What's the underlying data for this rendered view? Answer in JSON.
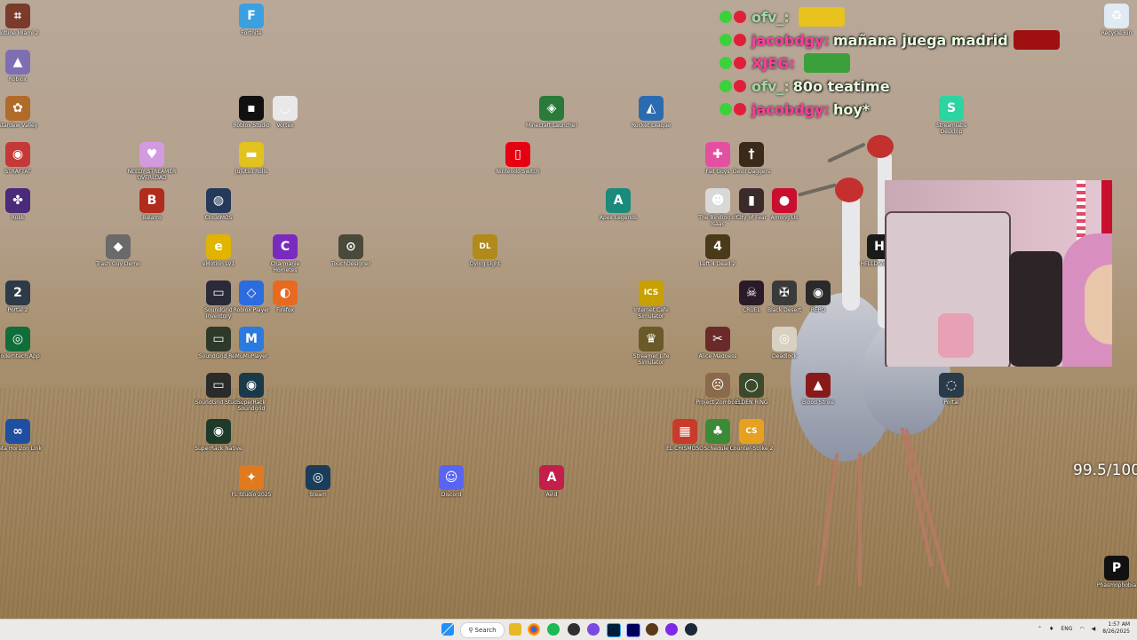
{
  "desktop_icons": [
    {
      "label": "Hotline Miami 2",
      "color": "#7a3b2a",
      "glyph": "⌗"
    },
    {
      "label": "Roblox",
      "color": "#7e6fb3",
      "glyph": "▲"
    },
    {
      "label": "Stardew Valley",
      "color": "#b06a2a",
      "glyph": "✿"
    },
    {
      "label": "STRAFTAT",
      "color": "#c53838",
      "glyph": "◉"
    },
    {
      "label": "Rukk",
      "color": "#4a2b7a",
      "glyph": "✤"
    },
    {
      "label": "Portal 2",
      "color": "#2c3a4a",
      "glyph": "2"
    },
    {
      "label": "Moderntech App",
      "color": "#0f6e3a",
      "glyph": "◎"
    },
    {
      "label": "Meta Horizon Link",
      "color": "#1f4fa0",
      "glyph": "∞"
    },
    {
      "label": "Fortnite",
      "color": "#3aa0e0",
      "glyph": "F"
    },
    {
      "label": "Roblox Studio",
      "color": "#111111",
      "glyph": "▪"
    },
    {
      "label": "Vortex",
      "color": "#e8e8e8",
      "glyph": "◡"
    },
    {
      "label": "NEEDY STREAMER OVERLOAD",
      "color": "#d39ae0",
      "glyph": "♥"
    },
    {
      "label": "Jujutsu Rolls",
      "color": "#e2c21d",
      "glyph": "▬"
    },
    {
      "label": "Balatro",
      "color": "#b02c1e",
      "glyph": "B"
    },
    {
      "label": "CloudMOS",
      "color": "#253a5a",
      "glyph": "◍"
    },
    {
      "label": "Trash Guy Demo",
      "color": "#6a6a6a",
      "glyph": "◆"
    },
    {
      "label": "eMotion LV1",
      "color": "#e0b400",
      "glyph": "e"
    },
    {
      "label": "Charmanie Hometes",
      "color": "#7a2bbf",
      "glyph": "C"
    },
    {
      "label": "TouchDesigner",
      "color": "#4a4a3a",
      "glyph": "⊙"
    },
    {
      "label": "SoundGrid Inventory",
      "color": "#2a2a3a",
      "glyph": "▭"
    },
    {
      "label": "Roblox Player",
      "color": "#2b6ce0",
      "glyph": "◇"
    },
    {
      "label": "Firefox",
      "color": "#e86a1f",
      "glyph": "◐"
    },
    {
      "label": "SoundGrid Rec",
      "color": "#2d3a2a",
      "glyph": "▭"
    },
    {
      "label": "MuMuPlayer",
      "color": "#2b7ae0",
      "glyph": "M"
    },
    {
      "label": "SoundGrid Studio",
      "color": "#2b2b2b",
      "glyph": "▭"
    },
    {
      "label": "SuperRack Soundgrid",
      "color": "#1a3a4a",
      "glyph": "◉"
    },
    {
      "label": "SuperRack Native",
      "color": "#1e3a2a",
      "glyph": "◉"
    },
    {
      "label": "FL Studio 2025",
      "color": "#e07a1f",
      "glyph": "✦"
    },
    {
      "label": "Steam",
      "color": "#1a3d5a",
      "glyph": "◎"
    },
    {
      "label": "Discord",
      "color": "#5865f2",
      "glyph": "☺"
    },
    {
      "label": "Avid",
      "color": "#c41e4a",
      "glyph": "A"
    },
    {
      "label": "Nintendo Switch",
      "color": "#e60012",
      "glyph": "▯"
    },
    {
      "label": "Dying Light",
      "color": "#b08a1a",
      "glyph": "DL"
    },
    {
      "label": "Minecraft Launcher",
      "color": "#2a7a3a",
      "glyph": "◈"
    },
    {
      "label": "Rocket League",
      "color": "#2b6cb0",
      "glyph": "◭"
    },
    {
      "label": "Apex Legends",
      "color": "#1a8a7a",
      "glyph": "A"
    },
    {
      "label": "Internet Cafe Simulator",
      "color": "#c8a000",
      "glyph": "ICS"
    },
    {
      "label": "Streamer Life Simulator",
      "color": "#6a5a2a",
      "glyph": "♛"
    },
    {
      "label": "Fall Guys",
      "color": "#e34fa1",
      "glyph": "✚"
    },
    {
      "label": "Devil Daggers",
      "color": "#3a2a1a",
      "glyph": "†"
    },
    {
      "label": "The Binding of Isaac",
      "color": "#d8d8d8",
      "glyph": "☻"
    },
    {
      "label": "City of Fear",
      "color": "#3a2a2a",
      "glyph": "▮"
    },
    {
      "label": "Among Us",
      "color": "#c8102e",
      "glyph": "●"
    },
    {
      "label": "Left 4 Dead 2",
      "color": "#4a3a1a",
      "glyph": "4"
    },
    {
      "label": "CRUEL",
      "color": "#2a1a2a",
      "glyph": "☠"
    },
    {
      "label": "Black Desert",
      "color": "#3a3a3a",
      "glyph": "✠"
    },
    {
      "label": "REPO",
      "color": "#2a2a2a",
      "glyph": "◉"
    },
    {
      "label": "Alice Madness",
      "color": "#6a2a2a",
      "glyph": "✂"
    },
    {
      "label": "Deadlock",
      "color": "#d8d0c0",
      "glyph": "◎"
    },
    {
      "label": "Project Zomboid",
      "color": "#8a6a4a",
      "glyph": "☹"
    },
    {
      "label": "ELDEN RING",
      "color": "#3a4a2a",
      "glyph": "◯"
    },
    {
      "label": "Blood Strike",
      "color": "#8a1a1a",
      "glyph": "▲"
    },
    {
      "label": "EL CHISMOSO",
      "color": "#c83a2a",
      "glyph": "▦"
    },
    {
      "label": "Schedule I",
      "color": "#3a8a3a",
      "glyph": "♣"
    },
    {
      "label": "Counter-Strike 2",
      "color": "#e8a01f",
      "glyph": "CS"
    },
    {
      "label": "Portal",
      "color": "#2a3a4a",
      "glyph": "◌"
    },
    {
      "label": "Recycle Bin",
      "color": "#dfeaf2",
      "glyph": "♻"
    },
    {
      "label": "Streamlabs Desktop",
      "color": "#2bd4a0",
      "glyph": "S"
    },
    {
      "label": "Phasmophobia",
      "color": "#111111",
      "glyph": "P"
    },
    {
      "label": "HELLDIVERS 2",
      "color": "#1a1a1a",
      "glyph": "H"
    }
  ],
  "chat": [
    {
      "user": "ofv_",
      "user_color": "#9ed8a0",
      "msg": "",
      "emote_color": "#e8c21d"
    },
    {
      "user": "jacobdgy",
      "user_color": "#ff3d9e",
      "msg": "mañana juega madrid",
      "emote_color": "#a01010"
    },
    {
      "user": "XJEG",
      "user_color": "#ff3d9e",
      "msg": "",
      "emote_color": "#3aa03a"
    },
    {
      "user": "ofv_",
      "user_color": "#9ed8a0",
      "msg": "80o teatime",
      "emote_color": ""
    },
    {
      "user": "jacobdgy",
      "user_color": "#ff3d9e",
      "msg": "hoy*",
      "emote_color": ""
    }
  ],
  "score_text": "99.5/100",
  "taskbar": {
    "search_label": "Search",
    "language": "ENG",
    "time": "1:57 AM",
    "date": "8/26/2025"
  }
}
